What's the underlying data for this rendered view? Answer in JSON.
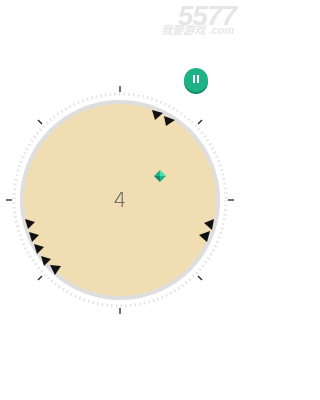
{
  "watermark": {
    "main": "5577",
    "sub": "我要游戏 .com"
  },
  "game": {
    "score": "4"
  },
  "controls": {
    "pause_icon": "pause-icon"
  },
  "colors": {
    "board": "#f0ddb2",
    "ring": "#dddddd",
    "spikes": "#111111",
    "gem": "#1db385",
    "pause": "#1db385"
  }
}
